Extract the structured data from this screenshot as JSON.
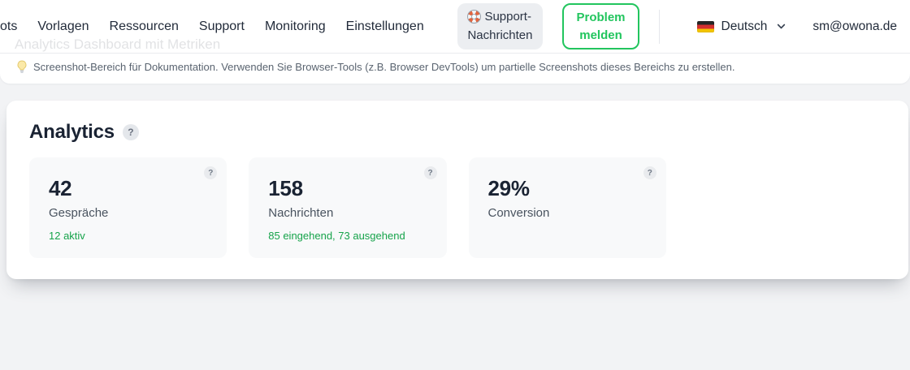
{
  "header": {
    "nav": [
      "ots",
      "Vorlagen",
      "Ressourcen",
      "Support",
      "Monitoring",
      "Einstellungen"
    ],
    "support_button": {
      "line1": "Support-",
      "line2": "Nachrichten"
    },
    "problem_button": {
      "line1": "Problem",
      "line2": "melden"
    },
    "language": {
      "label": "Deutsch"
    },
    "email": "sm@owona.de",
    "faded_title": "Analytics Dashboard mit Metriken"
  },
  "banner": {
    "text": "Screenshot-Bereich für Dokumentation. Verwenden Sie Browser-Tools (z.B. Browser DevTools) um partielle Screenshots dieses Bereichs zu erstellen."
  },
  "analytics": {
    "title": "Analytics",
    "help_label": "?",
    "cards": [
      {
        "value": "42",
        "label": "Gespräche",
        "sub": "12 aktiv"
      },
      {
        "value": "158",
        "label": "Nachrichten",
        "sub": "85 eingehend, 73 ausgehend"
      },
      {
        "value": "29%",
        "label": "Conversion",
        "sub": ""
      }
    ]
  },
  "colors": {
    "accent_green": "#22c55e",
    "stat_green": "#16a34a",
    "text_dark": "#1a2333"
  }
}
